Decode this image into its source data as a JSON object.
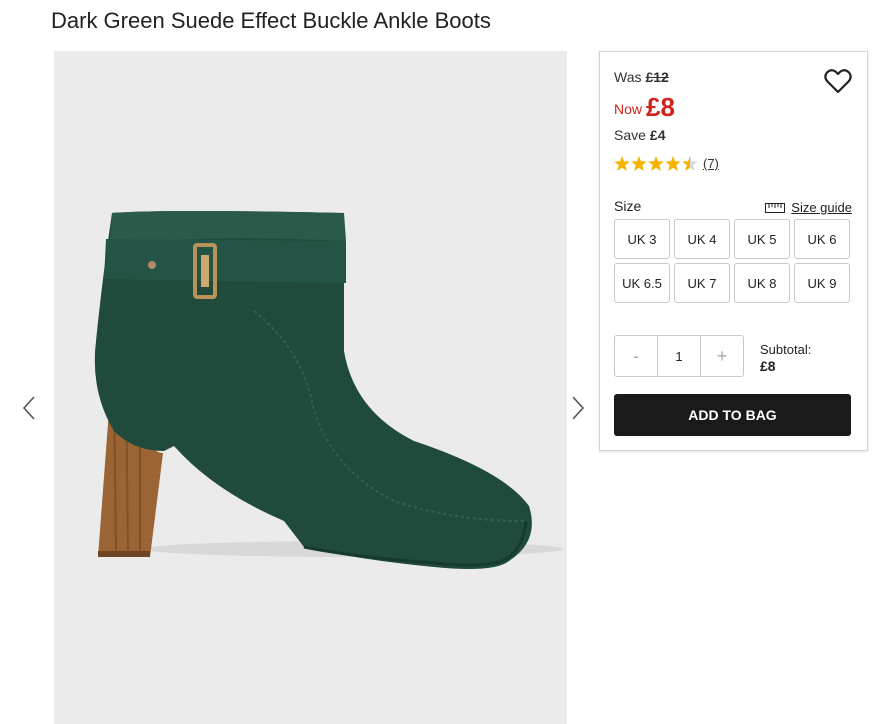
{
  "product": {
    "title": "Dark Green Suede Effect Buckle Ankle Boots",
    "image_alt": "Dark green suede effect ankle boot with buckle strap and stacked wooden heel"
  },
  "gallery": {
    "prev_icon": "chevron-left-icon",
    "next_icon": "chevron-right-icon"
  },
  "pricing": {
    "was_label": "Was",
    "was_price": "£12",
    "now_label": "Now",
    "now_price": "£8",
    "save_label": "Save",
    "save_amount": "£4"
  },
  "rating": {
    "stars": 4.5,
    "max": 5,
    "review_count": "(7)"
  },
  "size": {
    "label": "Size",
    "guide_label": "Size guide",
    "options": [
      "UK 3",
      "UK 4",
      "UK 5",
      "UK 6",
      "UK 6.5",
      "UK 7",
      "UK 8",
      "UK 9"
    ]
  },
  "quantity": {
    "minus": "-",
    "value": "1",
    "plus": "+"
  },
  "subtotal": {
    "label": "Subtotal:",
    "value": "£8"
  },
  "cart": {
    "add_label": "ADD TO BAG"
  },
  "colors": {
    "sale_red": "#d0221c",
    "star_gold": "#f5b300",
    "button_dark": "#1a1a1a",
    "boot_green": "#1f4a3c"
  }
}
